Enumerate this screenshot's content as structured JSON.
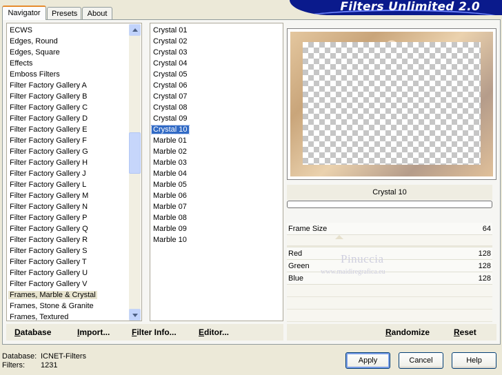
{
  "header": {
    "title": "Filters Unlimited 2.0"
  },
  "tabs": [
    {
      "label": "Navigator",
      "active": true
    },
    {
      "label": "Presets",
      "active": false
    },
    {
      "label": "About",
      "active": false
    }
  ],
  "categories": {
    "items": [
      "ECWS",
      "Edges, Round",
      "Edges, Square",
      "Effects",
      "Emboss Filters",
      "Filter Factory Gallery A",
      "Filter Factory Gallery B",
      "Filter Factory Gallery C",
      "Filter Factory Gallery D",
      "Filter Factory Gallery E",
      "Filter Factory Gallery F",
      "Filter Factory Gallery G",
      "Filter Factory Gallery H",
      "Filter Factory Gallery J",
      "Filter Factory Gallery L",
      "Filter Factory Gallery M",
      "Filter Factory Gallery N",
      "Filter Factory Gallery P",
      "Filter Factory Gallery Q",
      "Filter Factory Gallery R",
      "Filter Factory Gallery S",
      "Filter Factory Gallery T",
      "Filter Factory Gallery U",
      "Filter Factory Gallery V",
      "Frames, Marble & Crystal",
      "Frames, Stone & Granite",
      "Frames, Textured"
    ],
    "highlighted_index": 24
  },
  "filters": {
    "items": [
      "Crystal 01",
      "Crystal 02",
      "Crystal 03",
      "Crystal 04",
      "Crystal 05",
      "Crystal 06",
      "Crystal 07",
      "Crystal 08",
      "Crystal 09",
      "Crystal 10",
      "Marble 01",
      "Marble 02",
      "Marble 03",
      "Marble 04",
      "Marble 05",
      "Marble 06",
      "Marble 07",
      "Marble 08",
      "Marble 09",
      "Marble 10"
    ],
    "selected_index": 9
  },
  "preview": {
    "filter_name": "Crystal 10"
  },
  "params": {
    "frame_size": {
      "label": "Frame Size",
      "value": "64"
    },
    "red": {
      "label": "Red",
      "value": "128"
    },
    "green": {
      "label": "Green",
      "value": "128"
    },
    "blue": {
      "label": "Blue",
      "value": "128"
    }
  },
  "watermark": {
    "name": "Pinuccia",
    "url": "www.maidiregrafica.eu"
  },
  "toolbar": {
    "database": "Database",
    "import": "Import...",
    "filter_info": "Filter Info...",
    "editor": "Editor...",
    "randomize": "Randomize",
    "reset": "Reset"
  },
  "status": {
    "database_label": "Database:",
    "database_value": "ICNET-Filters",
    "filters_label": "Filters:",
    "filters_value": "1231"
  },
  "buttons": {
    "apply": "Apply",
    "cancel": "Cancel",
    "help": "Help"
  }
}
